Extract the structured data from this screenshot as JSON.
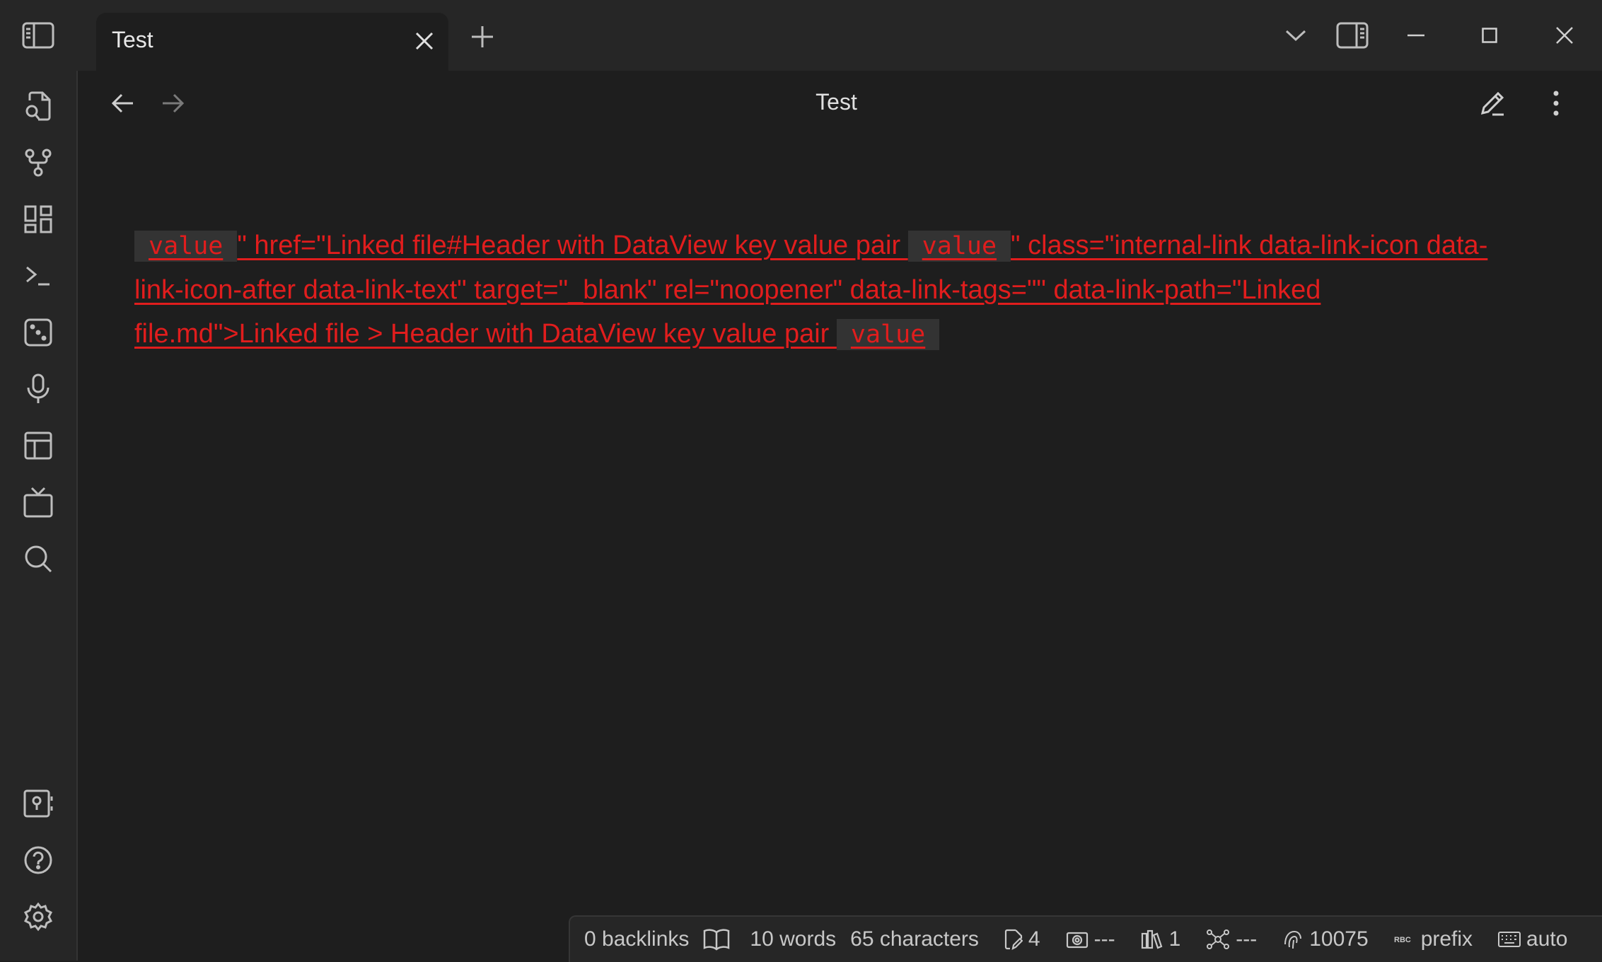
{
  "tab": {
    "title": "Test"
  },
  "view": {
    "title": "Test"
  },
  "content": {
    "code1": "value",
    "text1": "\" href=\"Linked file#Header with DataView key value pair ",
    "code2": "value",
    "text2": "\" class=\"internal-link data-link-icon data-link-icon-after data-link-text\" target=\"_blank\" rel=\"noopener\" data-link-tags=\"\" data-link-path=\"Linked file.md\">Linked file > Header with DataView key value pair ",
    "code3": "value"
  },
  "statusbar": {
    "backlinks": "0 backlinks",
    "words": "10 words",
    "characters": "65 characters",
    "edits": "4",
    "camera": "---",
    "library": "1",
    "graph": "---",
    "count": "10075",
    "prefix": "prefix",
    "keyboard": "auto"
  },
  "colors": {
    "background": "#1e1e1e",
    "titlebar": "#262626",
    "link_red": "#e11d1d",
    "code_bg": "#333333"
  },
  "icons": {
    "ribbon": [
      "sidebar-toggle-icon",
      "file-search-icon",
      "git-branch-icon",
      "dashboard-icon",
      "terminal-icon",
      "dice-icon",
      "microphone-icon",
      "layout-icon",
      "tv-icon",
      "search-icon",
      "vault-help-icon",
      "help-icon",
      "settings-icon"
    ]
  }
}
